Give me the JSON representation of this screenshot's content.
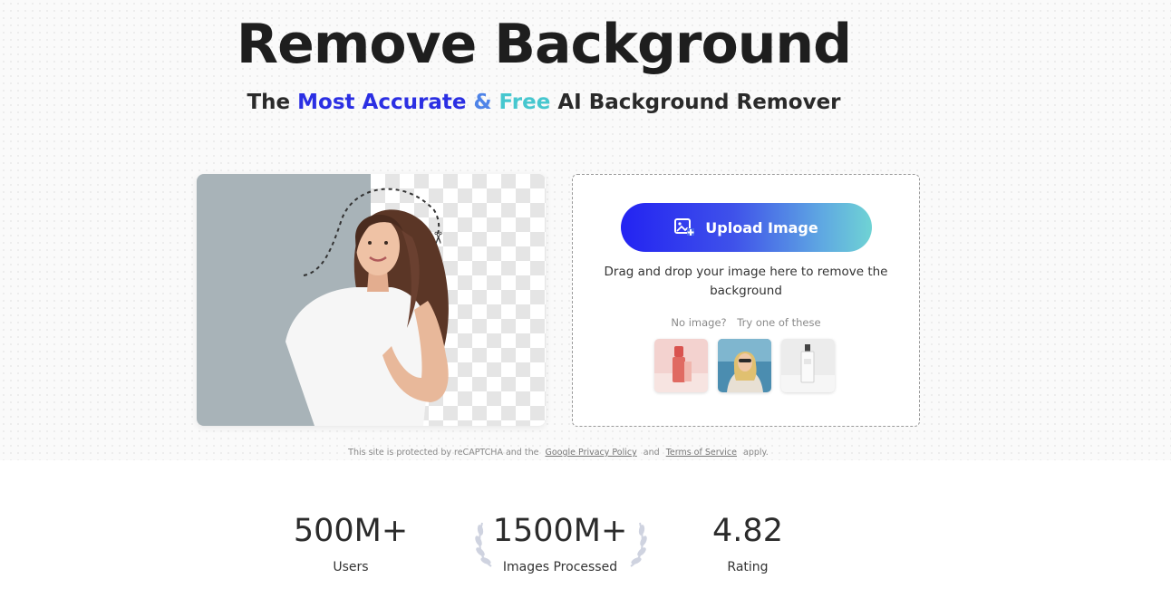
{
  "hero": {
    "title": "Remove Background",
    "subtitle_prefix": "The",
    "subtitle_highlight_1": "Most Accurate",
    "subtitle_amp": "&",
    "subtitle_highlight_2": "Free",
    "subtitle_suffix": "AI Background Remover"
  },
  "upload": {
    "button_label": "Upload Image",
    "button_icon": "image-add-icon",
    "drag_text": "Drag and drop your image here to remove the background",
    "no_image": "No image?",
    "try_text": "Try one of these",
    "samples": [
      {
        "name": "sample-lipstick",
        "icon": "lipstick-photo"
      },
      {
        "name": "sample-woman",
        "icon": "woman-photo"
      },
      {
        "name": "sample-perfume",
        "icon": "perfume-photo"
      }
    ]
  },
  "legal": {
    "prefix": "This site is protected by reCAPTCHA and the",
    "privacy_link": "Google Privacy Policy",
    "and": "and",
    "terms_link": "Terms of Service",
    "suffix": "apply."
  },
  "stats": [
    {
      "value": "500M+",
      "label": "Users"
    },
    {
      "value": "1500M+",
      "label": "Images Processed"
    },
    {
      "value": "4.82",
      "label": "Rating"
    }
  ],
  "colors": {
    "accent_blue": "#2b2fe3",
    "accent_teal": "#46c7cf",
    "button_gradient_start": "#2323f2",
    "button_gradient_end": "#6fd3d4"
  }
}
